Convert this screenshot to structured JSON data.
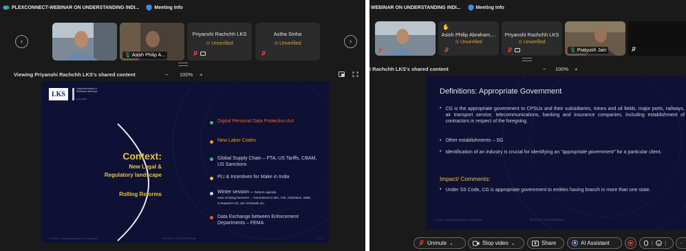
{
  "left": {
    "window_title": "PLEXCONNECT-WEBINAR ON UNDERSTANDING INDI...",
    "meeting_info": "Meeting Info",
    "participants": [
      {
        "name": "",
        "unverified": ""
      },
      {
        "name": "Asish Philip A...",
        "unverified": ""
      },
      {
        "name": "Priyanshi Rachchh LKS",
        "unverified": "Unverified"
      },
      {
        "name": "Astha Sinha",
        "unverified": "Unverified"
      }
    ],
    "viewing_label": "Viewing Priyanshi Rachchh LKS's shared content",
    "zoom": "100%",
    "zoom_minus": "−",
    "zoom_plus": "+",
    "slide": {
      "logo_text": "LKS",
      "logo_sub": "Lakshmikumaran & Sridharan attorneys",
      "logo_tag": "since 1985",
      "context_title": "Context:",
      "context_sub1": "New Legal &",
      "context_sub2": "Regulatory landscape",
      "rolling": "Rolling Reforms",
      "items": [
        {
          "text": "Digital Personal Data Protection Act",
          "color": "#e0623a"
        },
        {
          "text": "New Labor Codes",
          "color": "#e89a2c"
        },
        {
          "text": "Global Supply Chain – FTA, US Tariffs, CBAM, US Sanctions",
          "color": "#35b3a0"
        },
        {
          "text": "PLI & Incentives for",
          "italic": "Make in India",
          "color": "#e8c13a"
        },
        {
          "text": "Winter session –",
          "small": "Reform Agenda:",
          "italic_small": "ease of doing business",
          "small2": "– Amendment to IBC, FDI, Arbitration, SEBI, Companies Act, Jan Vishwash etc.",
          "color": "#cfd3e6"
        },
        {
          "text": "Data Exchange between Enforcement Departments – FEMA",
          "color": "#e05a3a"
        }
      ],
      "footer_left": "© 2025 | Lakshmikumaran & Sridharan",
      "footer_mid": "STRICTLY CONFIDENTIAL",
      "footer_right": "1 / 4"
    }
  },
  "right": {
    "window_title": "WEBINAR ON UNDERSTANDING INDI...",
    "meeting_info": "Meeting Info",
    "participants": [
      {
        "name": "",
        "unverified": ""
      },
      {
        "name": "Asish Philip Abraham,...",
        "unverified": "Unverified"
      },
      {
        "name": "Priyanshi Rachchh LKS",
        "unverified": "Unverified"
      },
      {
        "name": "Pratyush Jain",
        "unverified": ""
      }
    ],
    "viewing_label": "i Rachchh LKS's shared content",
    "zoom": "100%",
    "zoom_minus": "−",
    "zoom_plus": "+",
    "slide": {
      "title": "Definitions: Appropriate Government",
      "bullets": [
        "CG is the appropriate government to CPSUs and their subsidiaries, mines and oil fields, major ports, railways, air transport service, telecommunications, banking and insurance companies, including establishment of contractors in respect of the foregoing.",
        "Other establishments – SG"
      ],
      "bullet3_pre": "Identification of an industry is crucial for identifying an",
      "bullet3_italic": "\"appropriate government\"",
      "bullet3_post": "for a particular client.",
      "impact_title": "Impact/ Comments:",
      "impact_bullet": "Under SS Code, CG is appropriate government to entities having branch in more than one state.",
      "footer_left": "© 2025 | Lakshmikumaran & Sridharan",
      "footer_mid": "STRICTLY CONFIDENTIAL"
    },
    "toolbar": {
      "unmute": "Unmute",
      "stop_video": "Stop video",
      "share": "Share",
      "ai_assistant": "AI Assistant"
    }
  },
  "colors": {
    "accent_teal": "#2ec4a8",
    "unverified": "#d9a33a",
    "mute_red": "#e0453c",
    "slide_bg": "#0e1133",
    "slide_text_yellow": "#f0c43a"
  }
}
